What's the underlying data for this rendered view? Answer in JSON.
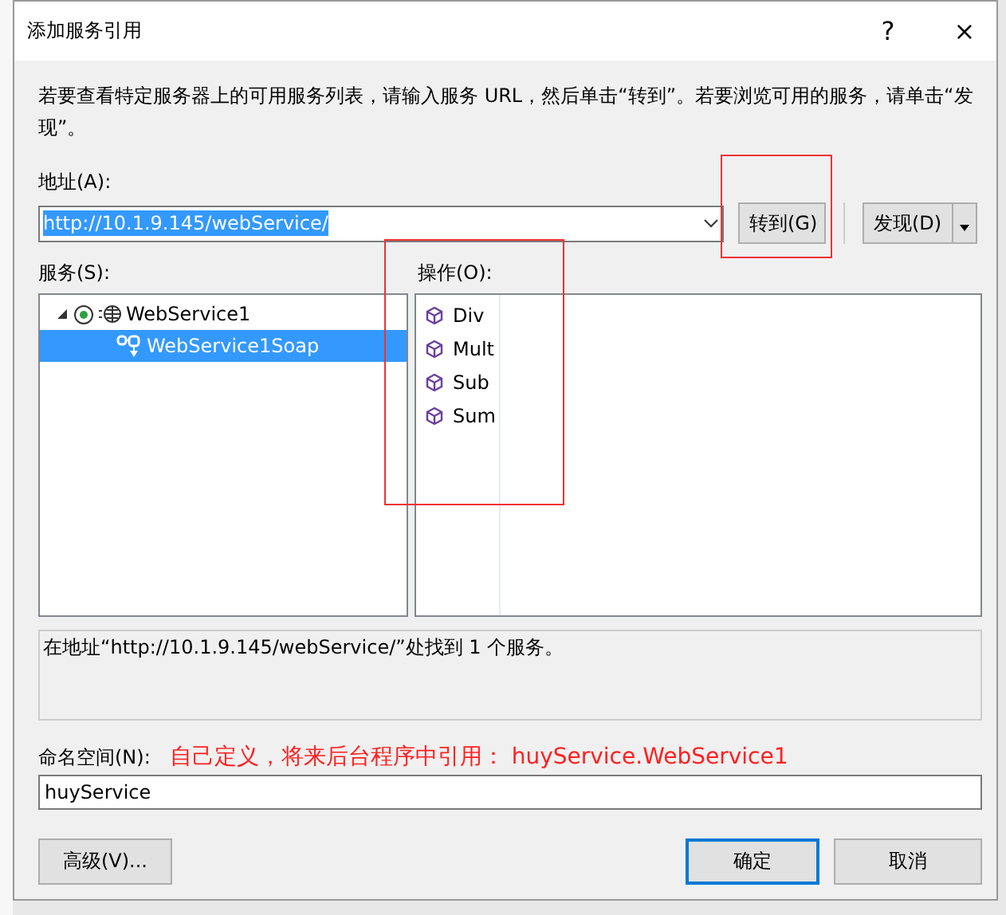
{
  "window": {
    "title": "添加服务引用",
    "help": "?",
    "close": "×"
  },
  "description": "若要查看特定服务器上的可用服务列表，请输入服务 URL，然后单击“转到”。若要浏览可用的服务，请单击“发现”。",
  "address": {
    "label": "地址(A):",
    "value": "http://10.1.9.145/webService/",
    "go_button": "转到(G)",
    "discover_button": "发现(D)"
  },
  "services": {
    "label": "服务(S):",
    "tree": [
      {
        "label": "WebService1",
        "expanded": true,
        "selected": false,
        "children": [
          {
            "label": "WebService1Soap",
            "selected": true
          }
        ]
      }
    ]
  },
  "operations": {
    "label": "操作(O):",
    "items": [
      "Div",
      "Mult",
      "Sub",
      "Sum"
    ]
  },
  "status": "在地址“http://10.1.9.145/webService/”处找到 1 个服务。",
  "namespace": {
    "label": "命名空间(N):",
    "value": "huyService",
    "note": "自己定义，将来后台程序中引用： huyService.WebService1"
  },
  "buttons": {
    "advanced": "高级(V)...",
    "ok": "确定",
    "cancel": "取消"
  }
}
